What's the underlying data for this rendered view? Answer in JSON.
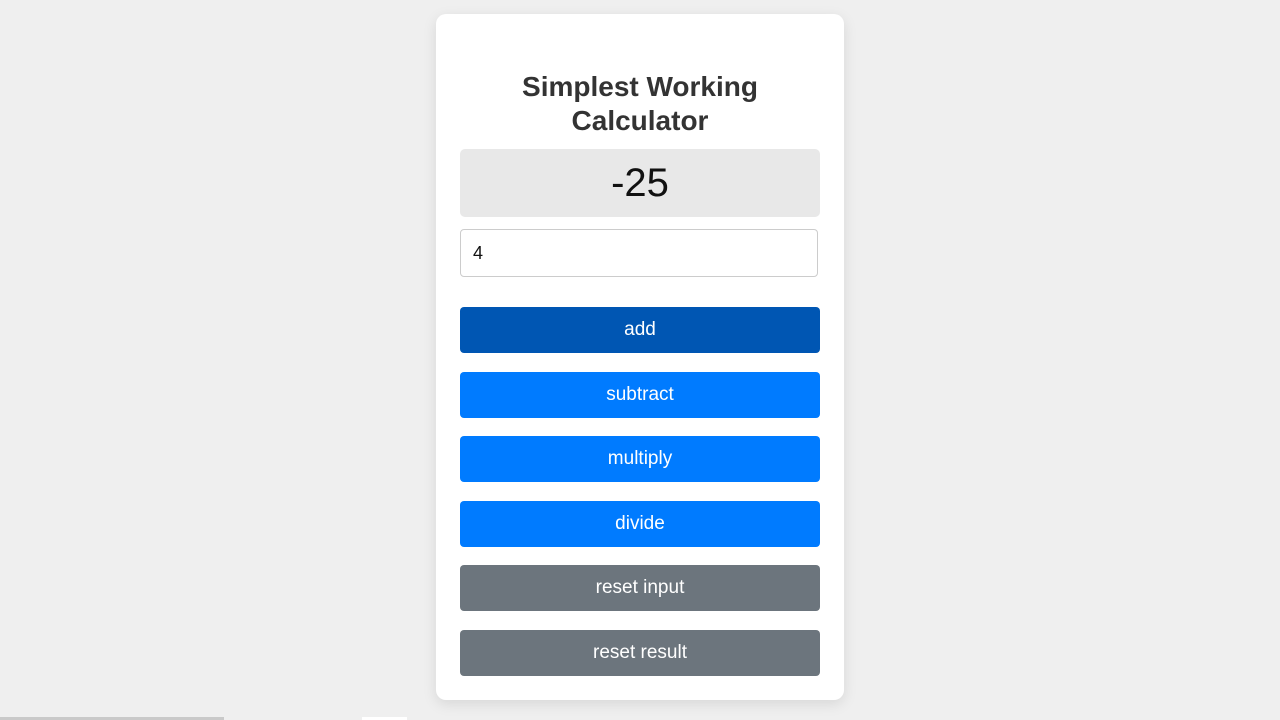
{
  "app": {
    "title_line1": "Simplest Working",
    "title_line2": "Calculator"
  },
  "result": {
    "value": "-25"
  },
  "input": {
    "value": "4",
    "placeholder": ""
  },
  "buttons": {
    "add": "add",
    "subtract": "subtract",
    "multiply": "multiply",
    "divide": "divide",
    "reset_input": "reset input",
    "reset_result": "reset result"
  },
  "colors": {
    "primary": "#007bff",
    "primary_active": "#0056b3",
    "secondary": "#6c757d",
    "result_bg": "#e8e8e8",
    "page_bg": "#efefef"
  }
}
